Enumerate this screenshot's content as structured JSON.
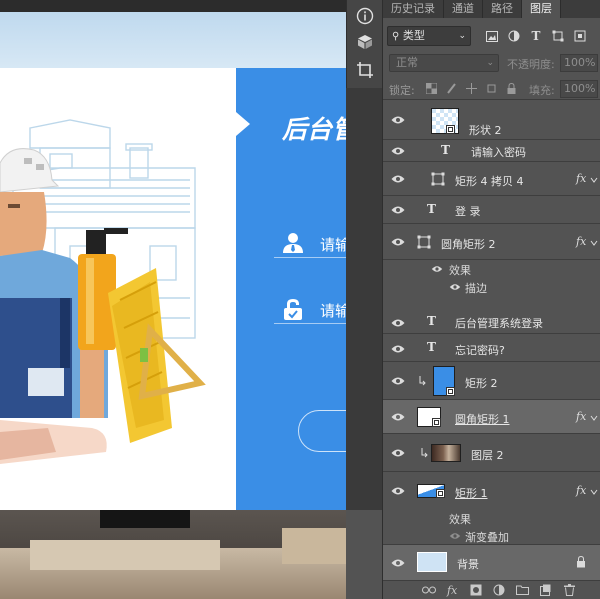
{
  "canvas": {
    "card_title": "后台管理",
    "username_placeholder": "请输入用",
    "password_placeholder": "请输入密"
  },
  "panel": {
    "tabs": [
      {
        "label": "历史记录",
        "active": false
      },
      {
        "label": "通道",
        "active": false
      },
      {
        "label": "路径",
        "active": false
      },
      {
        "label": "图层",
        "active": true
      }
    ],
    "filter_label": "类型",
    "blend_mode": "正常",
    "opacity_label": "不透明度:",
    "opacity_value": "100%",
    "lock_label": "锁定:",
    "fill_label": "填充:",
    "fill_value": "100%"
  },
  "layers": [
    {
      "name": "形状 2",
      "kind": "shape-thumb"
    },
    {
      "name": "请输入密码",
      "kind": "text"
    },
    {
      "name": "矩形 4 拷贝 4",
      "kind": "shape-icon",
      "fx": "fx"
    },
    {
      "name": "登 录",
      "kind": "text"
    },
    {
      "name": "圆角矩形 2",
      "kind": "shape-icon",
      "fx": "fx"
    },
    {
      "name": "效果",
      "kind": "effect-header"
    },
    {
      "name": "描边",
      "kind": "effect-item"
    },
    {
      "name": "后台管理系统登录",
      "kind": "text"
    },
    {
      "name": "忘记密码?",
      "kind": "text"
    },
    {
      "name": "矩形 2",
      "kind": "blue-thumb",
      "clipped": true
    },
    {
      "name": "圆角矩形 1",
      "kind": "white-thumb",
      "fx": "fx"
    },
    {
      "name": "图层 2",
      "kind": "photo-thumb",
      "clipped": true
    },
    {
      "name": "矩形 1",
      "kind": "mixed-thumb",
      "fx": "fx"
    },
    {
      "name": "效果",
      "kind": "effect-header"
    },
    {
      "name": "渐变叠加",
      "kind": "effect-item"
    },
    {
      "name": "背景",
      "kind": "background",
      "locked": true
    }
  ],
  "bottom_bar": {
    "icons": [
      "link-icon",
      "fx-icon",
      "mask-icon",
      "adjustment-icon",
      "group-folder-icon",
      "new-layer-icon",
      "trash-icon"
    ],
    "fx_text": "fx"
  },
  "colors": {
    "accent_blue": "#3a8ee6",
    "panel_bg": "#535353",
    "selected_row": "#686868"
  }
}
